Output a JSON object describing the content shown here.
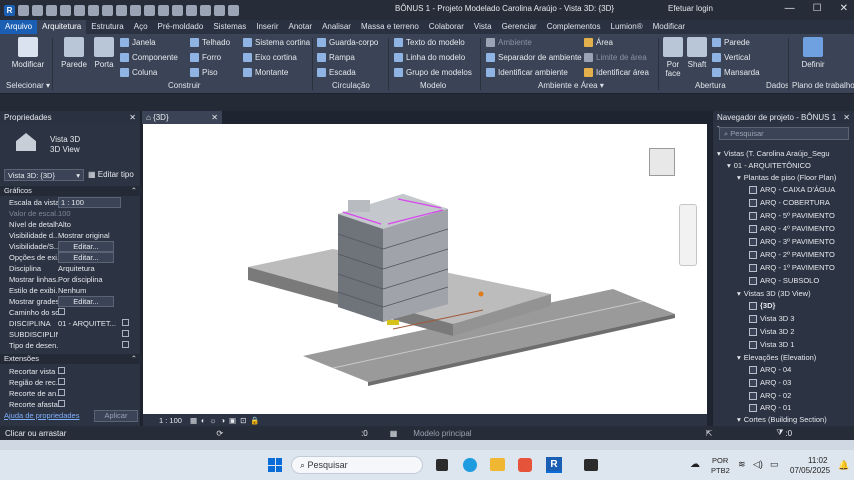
{
  "window": {
    "title": "BÔNUS 1 - Projeto Modelado Carolina Araújo - Vista 3D: {3D}",
    "login": "Efetuar login",
    "controls": [
      "—",
      "☐",
      "✕"
    ]
  },
  "tabs": [
    "Arquivo",
    "Arquitetura",
    "Estrutura",
    "Aço",
    "Pré-moldado",
    "Sistemas",
    "Inserir",
    "Anotar",
    "Analisar",
    "Massa e terreno",
    "Colaborar",
    "Vista",
    "Gerenciar",
    "Complementos",
    "Lumion®",
    "Modificar"
  ],
  "ribbon": {
    "modificar": "Modificar",
    "parede": "Parede",
    "porta": "Porta",
    "janela": "Janela",
    "componente": "Componente",
    "coluna": "Coluna",
    "telhado": "Telhado",
    "forro": "Forro",
    "piso": "Piso",
    "sistema_cortina": "Sistema cortina",
    "eixo_cortina": "Eixo cortina",
    "montante": "Montante",
    "guarda_corpo": "Guarda-corpo",
    "rampa": "Rampa",
    "escada": "Escada",
    "texto_modelo": "Texto do modelo",
    "linha_modelo": "Linha do modelo",
    "grupo_modelos": "Grupo de modelos",
    "ambiente": "Ambiente",
    "separador_ambiente": "Separador de ambiente",
    "identificar_ambiente": "Identificar ambiente",
    "area": "Área",
    "limite_area": "Limite de área",
    "identificar_area": "Identificar área",
    "por_face": "Por face",
    "shaft": "Shaft",
    "parede_ab": "Parede",
    "vertical": "Vertical",
    "mansarda": "Mansarda",
    "definir": "Definir",
    "panels": {
      "selecionar": "Selecionar ▾",
      "construir": "Construir",
      "circulacao": "Circulação",
      "modelo": "Modelo",
      "ambiente_area": "Ambiente e Área ▾",
      "abertura": "Abertura",
      "dados": "Dados",
      "plano": "Plano de trabalho"
    }
  },
  "properties": {
    "header": "Propriedades",
    "type_name": "Vista 3D",
    "type_sub": "3D View",
    "selector": "Vista 3D: {3D}",
    "edit_type": "Editar tipo",
    "section_graficos": "Gráficos",
    "rows": [
      {
        "k": "Escala da vista",
        "v": "1 : 100"
      },
      {
        "k": "Valor de escal...",
        "v": "100"
      },
      {
        "k": "Nível de detalhe",
        "v": "Alto"
      },
      {
        "k": "Visibilidade d...",
        "v": "Mostrar original"
      },
      {
        "k": "Visibilidade/S...",
        "v": "Editar..."
      },
      {
        "k": "Opções de exi...",
        "v": "Editar..."
      },
      {
        "k": "Disciplina",
        "v": "Arquitetura"
      },
      {
        "k": "Mostrar linhas...",
        "v": "Por disciplina"
      },
      {
        "k": "Estilo de exibi...",
        "v": "Nenhum"
      },
      {
        "k": "Mostrar grades",
        "v": "Editar..."
      },
      {
        "k": "Caminho do sol",
        "v": ""
      },
      {
        "k": "DISCIPLINA",
        "v": "01 - ARQUITET..."
      },
      {
        "k": "SUBDISCIPLINA",
        "v": ""
      },
      {
        "k": "Tipo de desen...",
        "v": ""
      }
    ],
    "section_extensoes": "Extensões",
    "ext_rows": [
      "Recortar vista",
      "Região de rec...",
      "Recorte de an...",
      "Recorte afasta..."
    ],
    "help_link": "Ajuda de propriedades",
    "apply": "Aplicar"
  },
  "view": {
    "tab": "{3D}",
    "scale": "1 : 100"
  },
  "navigator": {
    "header": "Navegador de projeto - BÔNUS 1 -...",
    "search_placeholder": "Pesquisar",
    "items": [
      "Vistas (T. Carolina Araújo_Segu",
      "01 - ARQUITETÔNICO",
      "Plantas de piso (Floor Plan)",
      "ARQ - CAIXA D'ÁGUA",
      "ARQ - COBERTURA",
      "ARQ - 5º PAVIMENTO",
      "ARQ - 4º PAVIMENTO",
      "ARQ - 3º PAVIMENTO",
      "ARQ - 2º PAVIMENTO",
      "ARQ - 1º PAVIMENTO",
      "ARQ - SUBSOLO",
      "Vistas 3D (3D View)",
      "{3D}",
      "Vista 3D 3",
      "Vista 3D 2",
      "Vista 3D 1",
      "Elevações (Elevation)",
      "ARQ - 04",
      "ARQ - 03",
      "ARQ - 02",
      "ARQ - 01",
      "Cortes (Building Section)"
    ]
  },
  "status": {
    "hint": "Clicar ou arrastar",
    "zero1": ":0",
    "model": "Modelo principal",
    "zero2": ":0"
  },
  "taskbar": {
    "search": "Pesquisar",
    "lang1": "POR",
    "lang2": "PTB2",
    "time": "11:02",
    "date": "07/05/2025"
  }
}
